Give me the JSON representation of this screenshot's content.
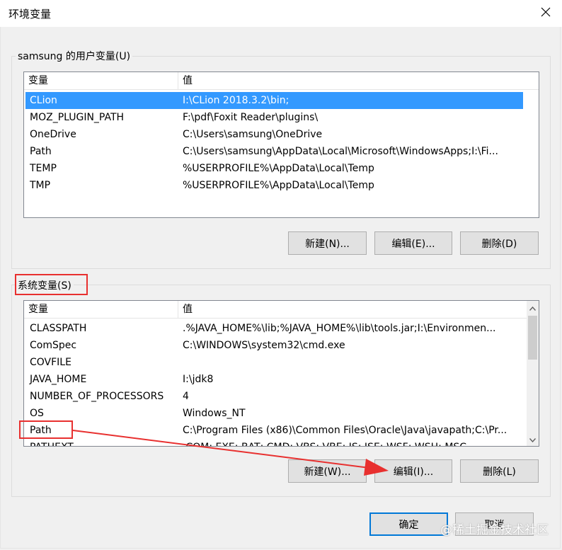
{
  "window": {
    "title": "环境变量"
  },
  "user_vars": {
    "group_label": "samsung 的用户变量(U)",
    "columns": [
      "变量",
      "值"
    ],
    "rows": [
      {
        "name": "CLion",
        "value": "I:\\CLion 2018.3.2\\bin;",
        "selected": true
      },
      {
        "name": "MOZ_PLUGIN_PATH",
        "value": "F:\\pdf\\Foxit Reader\\plugins\\"
      },
      {
        "name": "OneDrive",
        "value": "C:\\Users\\samsung\\OneDrive"
      },
      {
        "name": "Path",
        "value": "C:\\Users\\samsung\\AppData\\Local\\Microsoft\\WindowsApps;I:\\Fi..."
      },
      {
        "name": "TEMP",
        "value": "%USERPROFILE%\\AppData\\Local\\Temp"
      },
      {
        "name": "TMP",
        "value": "%USERPROFILE%\\AppData\\Local\\Temp"
      }
    ],
    "buttons": {
      "new": "新建(N)...",
      "edit": "编辑(E)...",
      "delete": "删除(D)"
    }
  },
  "system_vars": {
    "group_label": "系统变量(S)",
    "columns": [
      "变量",
      "值"
    ],
    "rows": [
      {
        "name": "CLASSPATH",
        "value": ".%JAVA_HOME%\\lib;%JAVA_HOME%\\lib\\tools.jar;I:\\Environmen..."
      },
      {
        "name": "ComSpec",
        "value": "C:\\WINDOWS\\system32\\cmd.exe"
      },
      {
        "name": "COVFILE",
        "value": ""
      },
      {
        "name": "JAVA_HOME",
        "value": "I:\\jdk8"
      },
      {
        "name": "NUMBER_OF_PROCESSORS",
        "value": "4"
      },
      {
        "name": "OS",
        "value": "Windows_NT"
      },
      {
        "name": "Path",
        "value": "C:\\Program Files (x86)\\Common Files\\Oracle\\Java\\javapath;C:\\Pr..."
      },
      {
        "name": "PATHEXT",
        "value": ".COM;.EXE;.BAT;.CMD;.VBS;.VBE;.JS;.JSE;.WSF;.WSH;.MSC"
      }
    ],
    "buttons": {
      "new": "新建(W)...",
      "edit": "编辑(I)...",
      "delete": "删除(L)"
    }
  },
  "footer": {
    "ok": "确定",
    "cancel": "取消"
  },
  "watermark": "@稀土掘金技术社区",
  "colors": {
    "selection": "#3399ff",
    "annotation": "#e8302f",
    "default_button_border": "#0078d7"
  },
  "icons": {
    "close": "close-icon",
    "scroll_up": "chevron-up-icon",
    "scroll_down": "chevron-down-icon"
  }
}
